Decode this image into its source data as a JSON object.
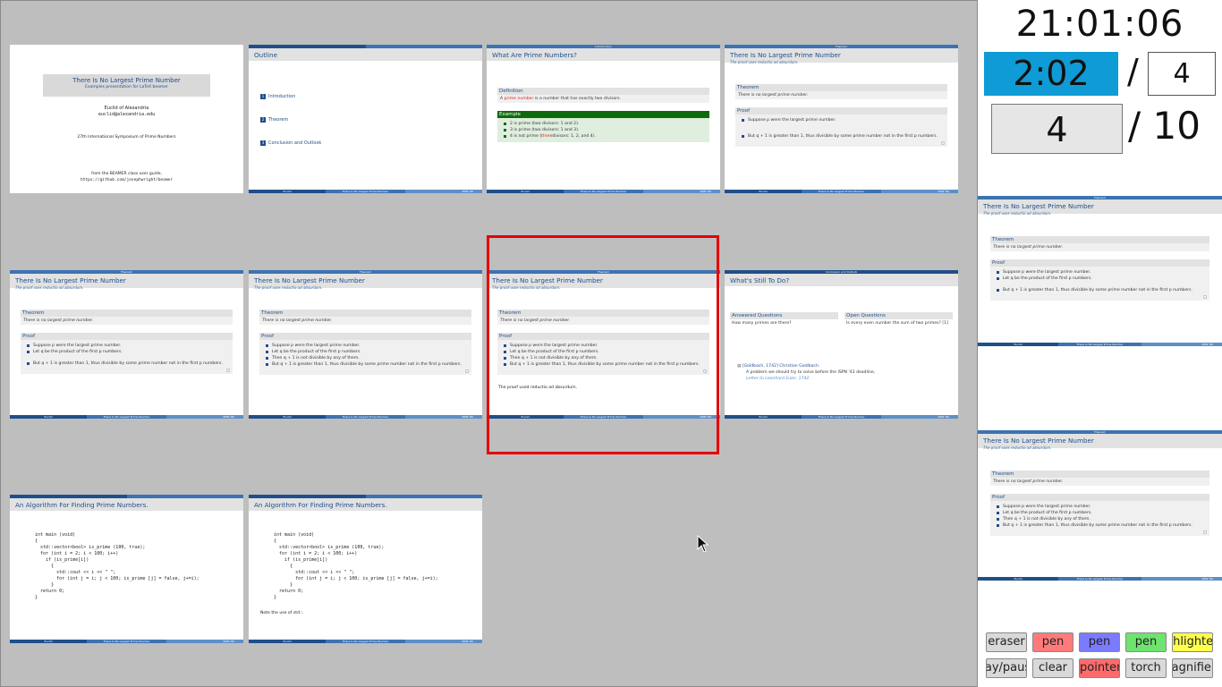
{
  "slides": {
    "title": {
      "title": "There Is No Largest Prime Number",
      "subtitle": "Examples presentation for LaTeX beamer",
      "author": "Euclid of Alexandria",
      "email": "euclid@alexandria.edu",
      "event": "27th International Symposium of Prime Numbers",
      "origin1": "from the BEAMER class user guide,",
      "origin2": "https://github.com/josephwright/beamer"
    },
    "outline": {
      "title": "Outline",
      "items": [
        "Introduction",
        "Theorem",
        "Conclusion and Outlook"
      ]
    },
    "what": {
      "section": "Introduction",
      "title": "What Are Prime Numbers?",
      "def_head": "Definition",
      "def_pre": "A ",
      "def_term": "prime number",
      "def_post": " is a number that has exactly two divisors.",
      "ex_head": "Example",
      "ex1": "2 is prime (two divisors: 1 and 2).",
      "ex2": "3 is prime (two divisors: 1 and 3).",
      "ex3_pre": "4 is not prime (",
      "ex3_term": "three",
      "ex3_post": " divisors: 1, 2, and 4)."
    },
    "theorem": {
      "section": "Theorem",
      "title": "There Is No Largest Prime Number",
      "subtitle": "The proof uses reductio ad absurdum.",
      "thm_head": "Theorem",
      "thm_body": "There is no largest prime number.",
      "proof_head": "Proof",
      "p1": "Suppose p were the largest prime number.",
      "p2": "Let q be the product of the first p numbers.",
      "p3": "Then q + 1 is not divisible by any of them.",
      "p4": "But q + 1 is greater than 1, thus divisible by some prime number not in the first p numbers.",
      "qed": "□",
      "conclusion": "The proof used reductio ad absurdum."
    },
    "todo": {
      "section": "Conclusion and Outlook",
      "title": "What's Still To Do?",
      "ans_head": "Answered Questions",
      "ans_body": "How many primes are there?",
      "open_head": "Open Questions",
      "open_body": "Is every even number the sum of two primes? [1]",
      "ref_label": "[Goldbach, 1742] Christian Goldbach.",
      "ref_line2": "A problem we should try to solve before the ISPN '43 deadline,",
      "ref_line3": "Letter to Leonhard Euler, 1742."
    },
    "algo": {
      "title": "An Algorithm For Finding Prime Numbers.",
      "code": "int main (void)\n{\n  std::vector<bool> is_prime (100, true);\n  for (int i = 2; i < 100; i++)\n    if (is_prime[i])\n      {\n        std::cout << i << \" \";\n        for (int j = i; j < 100; is_prime [j] = false, j+=i);\n      }\n  return 0;\n}",
      "note": "Note the use of std::."
    },
    "footer": {
      "author": "Euclid",
      "title": "There Is No Largest Prime Number",
      "date": "ISPN '80"
    }
  },
  "panel": {
    "clock": "21:01:06",
    "timer": "2:02",
    "slash": "/",
    "timer_target": "4",
    "current_page": "4",
    "total_pages": "/ 10"
  },
  "tools": {
    "row1": [
      "eraser",
      "pen",
      "pen",
      "pen",
      "highlighter"
    ],
    "row2": [
      "play/pause",
      "clear",
      "pointer",
      "torch",
      "magnifier"
    ],
    "colors": {
      "eraser": "#c8c8c8",
      "pen_red": "#ff7b7b",
      "pen_blue": "#7b7bff",
      "pen_green": "#6fe36f",
      "highlighter": "#ffff4d",
      "pointer": "#ff6b6b",
      "neutral": "#d9d9d9"
    }
  },
  "colors": {
    "selection": "#e40000",
    "timer_bg": "#0f9bd5",
    "beamer_blue": "#1f4e8c",
    "example_green": "#0d6b0d"
  }
}
